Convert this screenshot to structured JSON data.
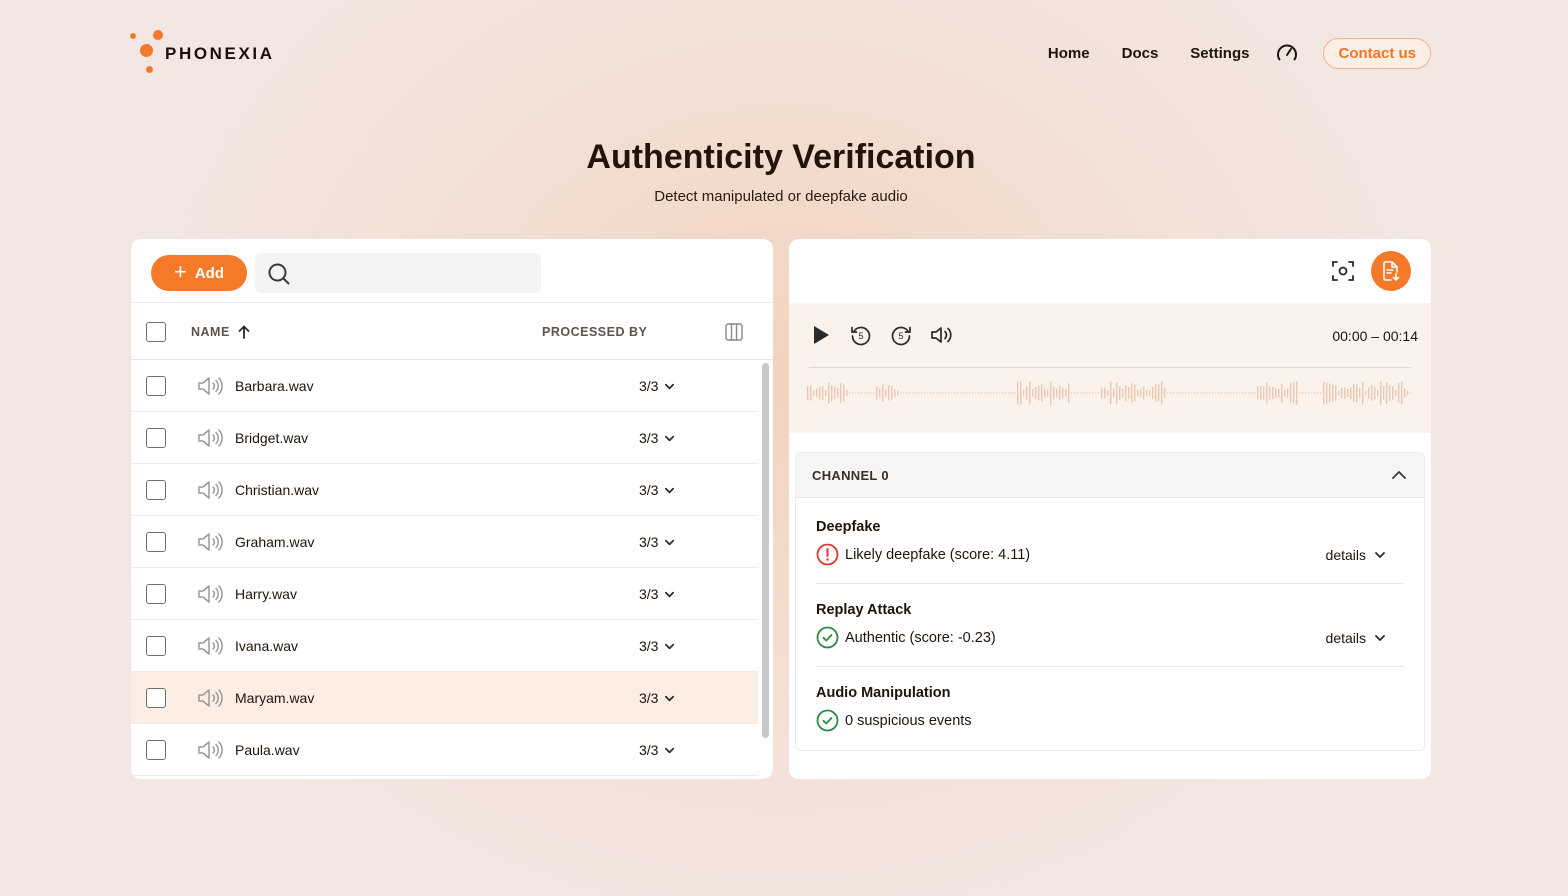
{
  "brand": {
    "name": "PHONEXIA",
    "accent": "#f47a2a"
  },
  "nav": {
    "home": "Home",
    "docs": "Docs",
    "settings": "Settings",
    "contact": "Contact us"
  },
  "page": {
    "title": "Authenticity Verification",
    "subtitle": "Detect manipulated or deepfake audio"
  },
  "toolbar": {
    "add_label": "Add",
    "search_placeholder": ""
  },
  "table": {
    "col_name": "NAME",
    "col_processed": "PROCESSED BY",
    "rows": [
      {
        "name": "Barbara.wav",
        "processed": "3/3",
        "selected": false
      },
      {
        "name": "Bridget.wav",
        "processed": "3/3",
        "selected": false
      },
      {
        "name": "Christian.wav",
        "processed": "3/3",
        "selected": false
      },
      {
        "name": "Graham.wav",
        "processed": "3/3",
        "selected": false
      },
      {
        "name": "Harry.wav",
        "processed": "3/3",
        "selected": false
      },
      {
        "name": "Ivana.wav",
        "processed": "3/3",
        "selected": false
      },
      {
        "name": "Maryam.wav",
        "processed": "3/3",
        "selected": true
      },
      {
        "name": "Paula.wav",
        "processed": "3/3",
        "selected": false
      }
    ]
  },
  "player": {
    "time_range": "00:00 – 00:14",
    "skip_seconds": "5"
  },
  "channel": {
    "title": "CHANNEL 0",
    "results": [
      {
        "title": "Deepfake",
        "result": "Likely deepfake (score: 4.11)",
        "status": "warning",
        "details": "details"
      },
      {
        "title": "Replay Attack",
        "result": "Authentic (score: -0.23)",
        "status": "ok",
        "details": "details"
      },
      {
        "title": "Audio Manipulation",
        "result": "0 suspicious events",
        "status": "ok"
      }
    ]
  },
  "colors": {
    "ok": "#2e8b45",
    "warning": "#d83a3a",
    "waveform": "#e9c7b3"
  }
}
